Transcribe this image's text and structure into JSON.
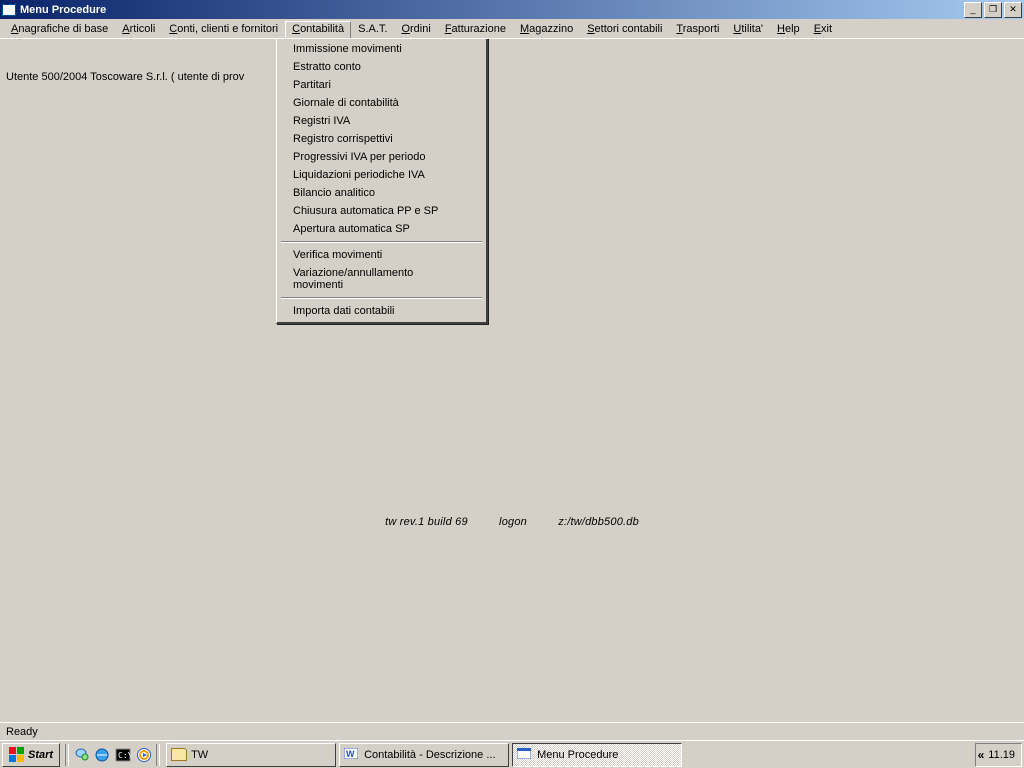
{
  "window": {
    "title": "Menu Procedure"
  },
  "menubar": [
    {
      "label": "Anagrafiche di base",
      "accel": "A"
    },
    {
      "label": "Articoli",
      "accel": "A"
    },
    {
      "label": "Conti, clienti e fornitori",
      "accel": "C"
    },
    {
      "label": "Contabilità",
      "accel": "C",
      "active": true
    },
    {
      "label": "S.A.T."
    },
    {
      "label": "Ordini",
      "accel": "O"
    },
    {
      "label": "Fatturazione",
      "accel": "F"
    },
    {
      "label": "Magazzino",
      "accel": "M"
    },
    {
      "label": "Settori contabili",
      "accel": "S"
    },
    {
      "label": "Trasporti",
      "accel": "T"
    },
    {
      "label": "Utilita'",
      "accel": "U"
    },
    {
      "label": "Help",
      "accel": "H"
    },
    {
      "label": "Exit",
      "accel": "E"
    }
  ],
  "dropdown": {
    "groups": [
      [
        "Immissione movimenti",
        "Estratto conto",
        "Partitari",
        "Giornale di contabilità",
        "Registri IVA",
        "Registro corrispettivi",
        "Progressivi IVA per periodo",
        "Liquidazioni periodiche IVA",
        "Bilancio analitico",
        "Chiusura automatica PP e SP",
        "Apertura automatica SP"
      ],
      [
        "Verifica movimenti",
        "Variazione/annullamento movimenti"
      ],
      [
        "Importa dati contabili"
      ]
    ]
  },
  "content": {
    "caption": "Utente 500/2004 Toscoware S.r.l. ( utente di prov",
    "info": {
      "version": "tw rev.1 build 69",
      "user": "logon",
      "db": "z:/tw/dbb500.db"
    }
  },
  "statusbar": {
    "text": "Ready"
  },
  "taskbar": {
    "start": "Start",
    "tasks": [
      {
        "label": "TW",
        "kind": "folder"
      },
      {
        "label": "Contabilità - Descrizione ...",
        "kind": "word"
      },
      {
        "label": "Menu Procedure",
        "kind": "app",
        "pressed": true
      }
    ],
    "clock": "11.19"
  }
}
